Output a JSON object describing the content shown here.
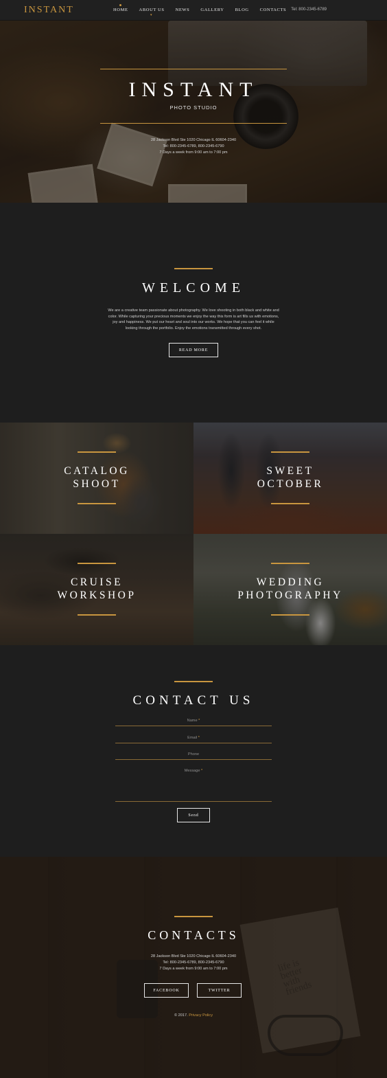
{
  "header": {
    "logo": "INSTANT",
    "nav": [
      "HOME",
      "ABOUT US",
      "NEWS",
      "GALLERY",
      "BLOG",
      "CONTACTS"
    ],
    "tel": "Tel: 800-2345-6789"
  },
  "hero": {
    "title": "INSTANT",
    "subtitle": "PHOTO STUDIO",
    "address": "28 Jackson Blvd Ste 1020 Chicago IL 60604-2340",
    "phones": "Tel: 800-2345-6789, 800-2345-6790",
    "hours": "7 Days a week from 9:00 am to 7:00 pm"
  },
  "welcome": {
    "title": "WELCOME",
    "text": "We are a creative team passionate about photography. We love shooting in both black and white and color. While capturing your precious moments we enjoy the way this form is art fills us with emotions, joy and happiness. We put our heart and soul into our works. We hope that you can feel it while looking through the portfolio. Enjoy the emotions transmitted through every shot.",
    "button": "READ MORE"
  },
  "gallery": [
    {
      "line1": "CATALOG",
      "line2": "SHOOT"
    },
    {
      "line1": "SWEET",
      "line2": "OCTOBER"
    },
    {
      "line1": "CRUISE",
      "line2": "WORKSHOP"
    },
    {
      "line1": "WEDDING",
      "line2": "PHOTOGRAPHY"
    }
  ],
  "contact": {
    "title": "CONTACT US",
    "name_label": "Name",
    "email_label": "Email",
    "phone_label": "Phone",
    "message_label": "Message",
    "required_mark": "*",
    "send": "Send"
  },
  "footer": {
    "title": "CONTACTS",
    "address": "28 Jackson Blvd Ste 1020 Chicago IL 60604-2340",
    "phones": "Tel: 800-2345-6789, 800-2345-6790",
    "hours": "7 Days a week from 9:00 am to 7:00 pm",
    "facebook": "FACEBOOK",
    "twitter": "TWITTER",
    "copyright": "© 2017.",
    "privacy": "Privacy Policy",
    "note_text": "life is better with friends"
  },
  "colors": {
    "accent": "#c9963f",
    "background": "#1e1e1e"
  }
}
